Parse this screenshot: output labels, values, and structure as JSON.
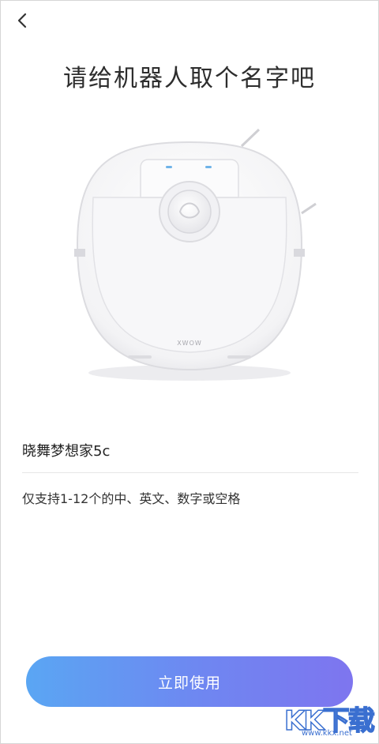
{
  "header": {
    "back_icon": "chevron-left-icon",
    "title": "请给机器人取个名字吧"
  },
  "device_image": {
    "brand_mark": "XWOW"
  },
  "name_field": {
    "value": "晓舞梦想家5c"
  },
  "hint": "仅支持1-12个的中、英文、数字或空格",
  "primary_button": {
    "label": "立即使用"
  },
  "watermark": {
    "logo_text": "KK下载",
    "url": "www.kkx.net"
  },
  "colors": {
    "button_gradient_start": "#5aa6f3",
    "button_gradient_end": "#7e75ef",
    "title_text": "#2d2d2d"
  }
}
